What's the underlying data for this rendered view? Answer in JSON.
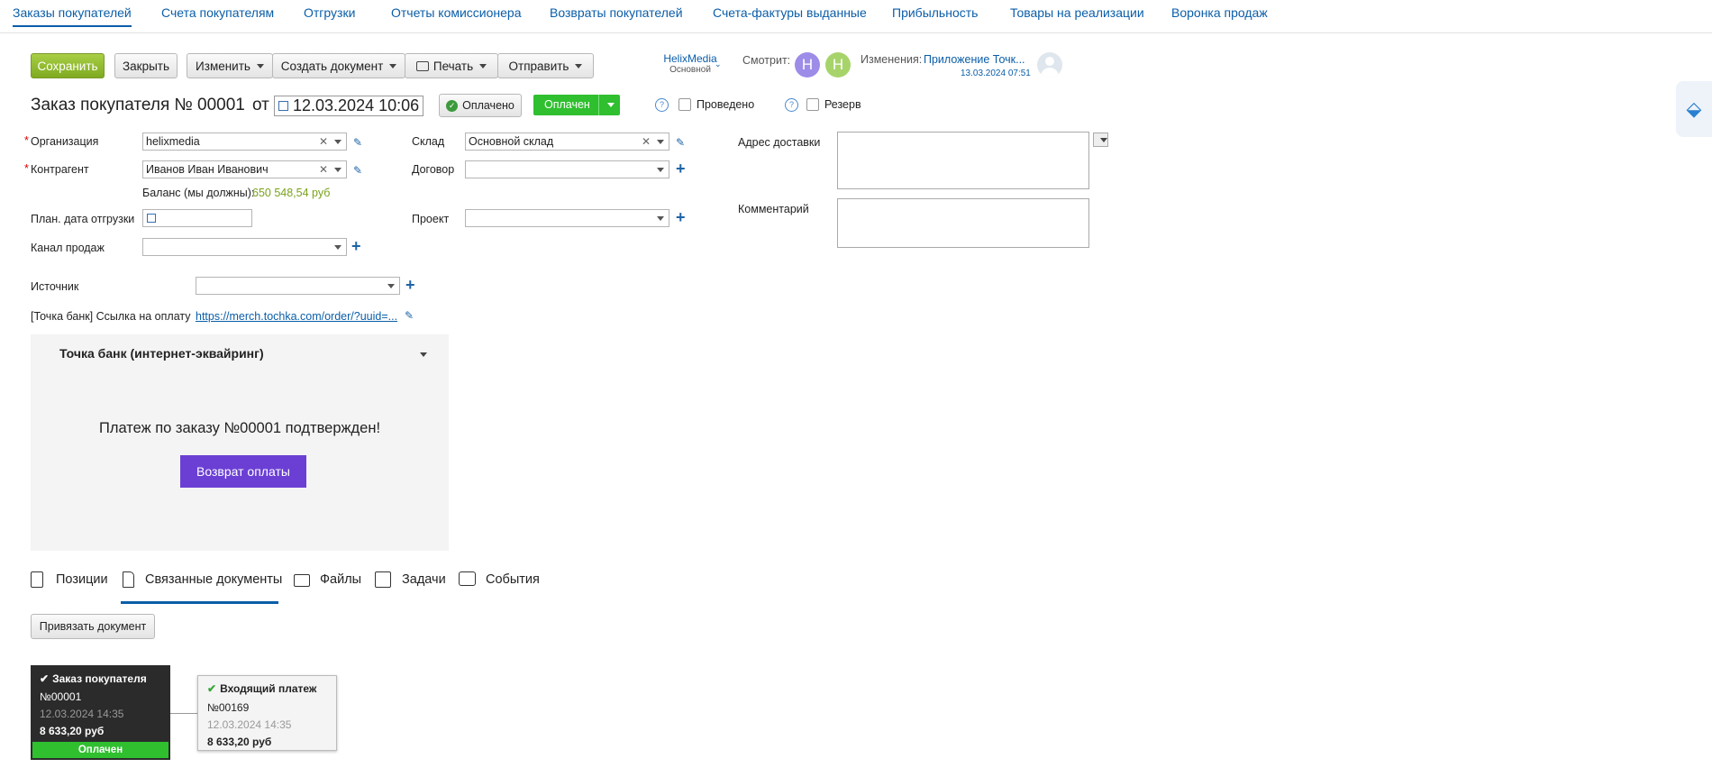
{
  "nav": {
    "items": [
      "Заказы покупателей",
      "Счета покупателям",
      "Отгрузки",
      "Отчеты комиссионера",
      "Возвраты покупателей",
      "Счета-фактуры выданные",
      "Прибыльность",
      "Товары на реализации",
      "Воронка продаж"
    ]
  },
  "toolbar": {
    "save": "Сохранить",
    "close": "Закрыть",
    "edit": "Изменить",
    "create_doc": "Создать документ",
    "print": "Печать",
    "send": "Отправить",
    "account_name": "HelixMedia",
    "account_sub": "Основной",
    "viewing_label": "Смотрит:",
    "avatar1": "H",
    "avatar2": "H",
    "changes_label": "Изменения:",
    "changes_link": "Приложение Точк...",
    "changes_date": "13.03.2024 07:51"
  },
  "header": {
    "title": "Заказ покупателя №",
    "number": "00001",
    "from": "от",
    "date": "12.03.2024 10:06",
    "paid_button": "Оплачено",
    "status": "Оплачен",
    "posted_label": "Проведено",
    "reserve_label": "Резерв",
    "help": "?"
  },
  "form": {
    "org_label": "Организация",
    "org_value": "helixmedia",
    "counterparty_label": "Контрагент",
    "counterparty_value": "Иванов Иван Иванович",
    "balance_label": "Баланс (мы должны):",
    "balance_value": "650 548,54 руб",
    "ship_date_label": "План. дата отгрузки",
    "channel_label": "Канал продаж",
    "warehouse_label": "Склад",
    "warehouse_value": "Основной склад",
    "contract_label": "Договор",
    "project_label": "Проект",
    "delivery_label": "Адрес доставки",
    "comment_label": "Комментарий",
    "source_label": "Источник",
    "pay_link_label": "[Точка банк] Ссылка на оплату",
    "pay_link_value": "https://merch.tochka.com/order/?uuid=..."
  },
  "widget": {
    "title": "Точка банк (интернет-эквайринг)",
    "message": "Платеж по заказу №00001 подтвержден!",
    "refund_button": "Возврат оплаты"
  },
  "tabs": [
    "Позиции",
    "Связанные документы",
    "Файлы",
    "Задачи",
    "События"
  ],
  "link_doc_button": "Привязать документ",
  "doc_cards": [
    {
      "title": "Заказ покупателя",
      "number": "№00001",
      "date": "12.03.2024 14:35",
      "amount": "8 633,20 руб",
      "status": "Оплачен"
    },
    {
      "title": "Входящий платеж",
      "number": "№00169",
      "date": "12.03.2024 14:35",
      "amount": "8 633,20 руб"
    }
  ],
  "colors": {
    "accent": "#0b5ea8",
    "green": "#2fbf2f",
    "purple": "#6b3fd4",
    "balance": "#7aa21c"
  }
}
